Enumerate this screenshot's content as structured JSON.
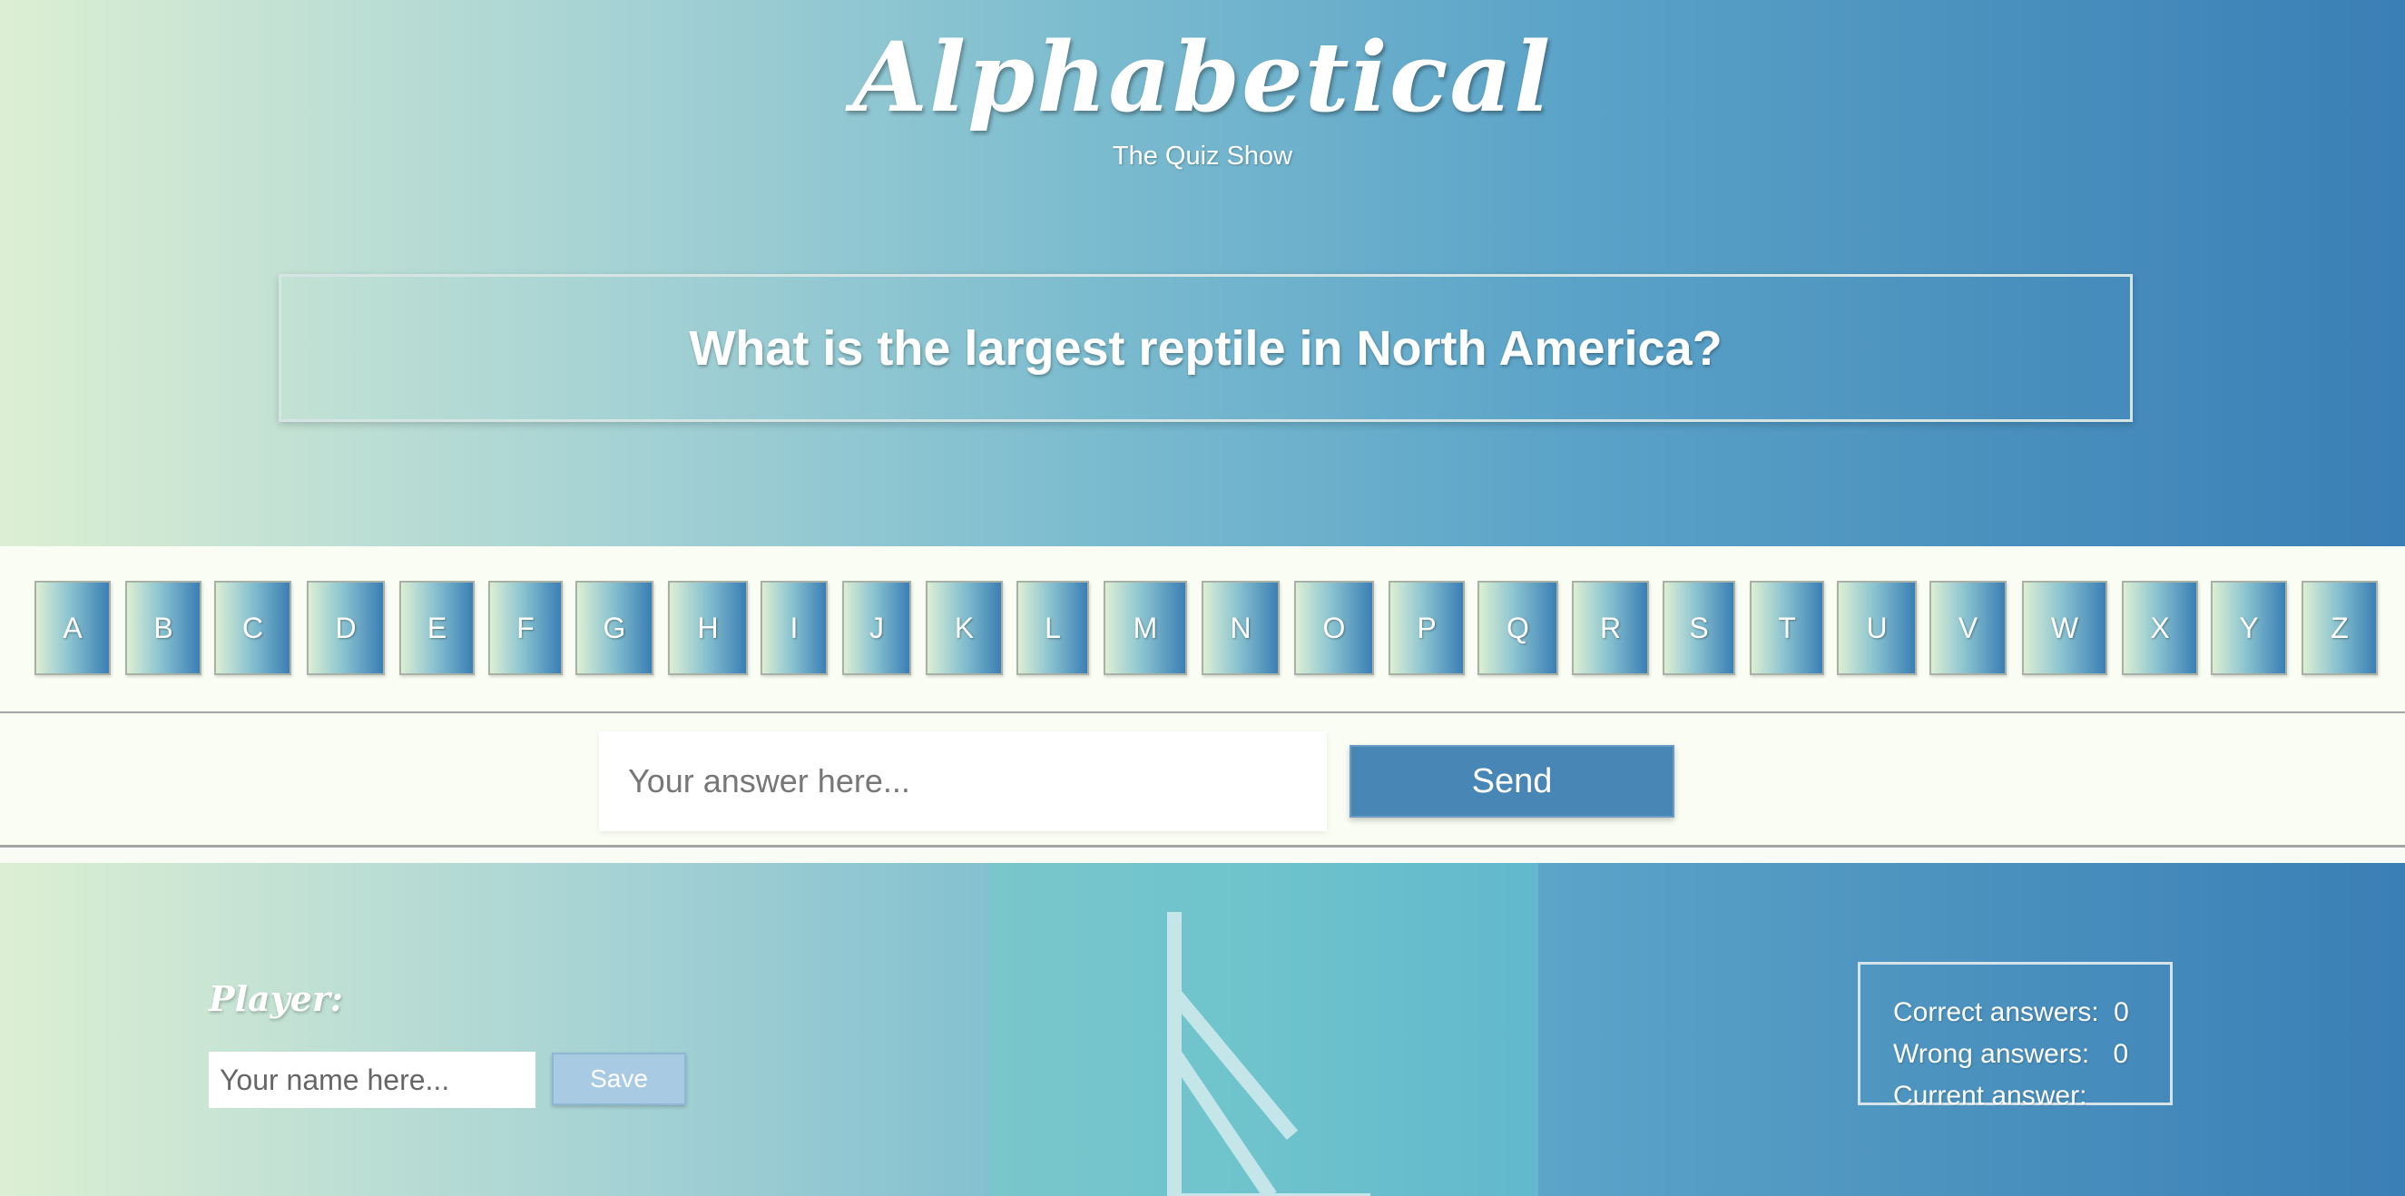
{
  "header": {
    "title": "Alphabetical",
    "subtitle": "The Quiz Show",
    "question": "What is the largest reptile in North America?"
  },
  "letters": [
    "A",
    "B",
    "C",
    "D",
    "E",
    "F",
    "G",
    "H",
    "I",
    "J",
    "K",
    "L",
    "M",
    "N",
    "O",
    "P",
    "Q",
    "R",
    "S",
    "T",
    "U",
    "V",
    "W",
    "X",
    "Y",
    "Z"
  ],
  "answer": {
    "placeholder": "Your answer here...",
    "value": "",
    "send_label": "Send"
  },
  "player": {
    "label": "Player:",
    "name_placeholder": "Your name here...",
    "save_label": "Save"
  },
  "stats": {
    "correct_label": "Correct answers:",
    "correct_value": "0",
    "wrong_label": "Wrong answers:",
    "wrong_value": "0",
    "current_label": "Current answer:",
    "current_value": ""
  },
  "colors": {
    "gradient_start": "#dcefd3",
    "gradient_end": "#3a7fb5",
    "send_button": "#4886b6",
    "save_button": "#a8cbe3",
    "logo_panel": "#6ec3cc"
  },
  "icons": {
    "logo": "alphabetical-logo-icon"
  }
}
